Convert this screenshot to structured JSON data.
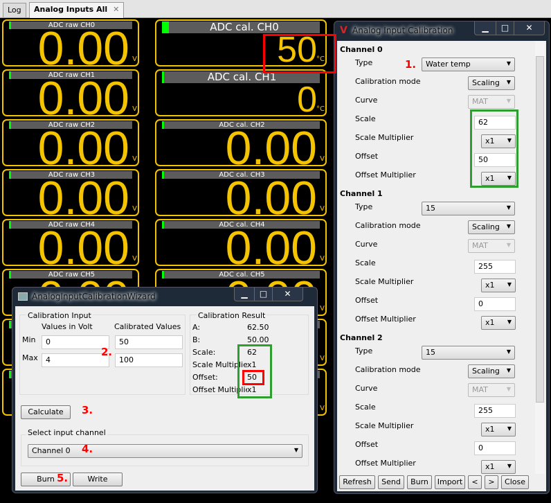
{
  "tabs": [
    {
      "label": "Log"
    },
    {
      "label": "Analog Inputs All",
      "close": "✕"
    }
  ],
  "gauges": {
    "raw": [
      {
        "title": "ADC raw CH0",
        "value": "0.00",
        "unit": "V"
      },
      {
        "title": "ADC raw CH1",
        "value": "0.00",
        "unit": "V"
      },
      {
        "title": "ADC raw CH2",
        "value": "0.00",
        "unit": "V"
      },
      {
        "title": "ADC raw CH3",
        "value": "0.00",
        "unit": "V"
      },
      {
        "title": "ADC raw CH4",
        "value": "0.00",
        "unit": "V"
      },
      {
        "title": "ADC raw CH5",
        "value": "0.00",
        "unit": "V"
      },
      {
        "title": "",
        "value": "",
        "unit": "V"
      },
      {
        "title": "",
        "value": "",
        "unit": "V"
      }
    ],
    "cal": [
      {
        "title": "ADC cal. CH0",
        "value": "50",
        "unit": "°C"
      },
      {
        "title": "ADC cal. CH1",
        "value": "0",
        "unit": "°C"
      },
      {
        "title": "ADC cal. CH2",
        "value": "0.00",
        "unit": "V"
      },
      {
        "title": "ADC cal. CH3",
        "value": "0.00",
        "unit": "V"
      },
      {
        "title": "ADC cal. CH4",
        "value": "0.00",
        "unit": "V"
      },
      {
        "title": "ADC cal. CH5",
        "value": "0.00",
        "unit": "V"
      },
      {
        "title": "",
        "value": "",
        "unit": "V"
      },
      {
        "title": "",
        "value": "",
        "unit": "V"
      }
    ]
  },
  "calib_window": {
    "title": "Analog Input Calibration",
    "controls": [
      "▁",
      "□",
      "✕"
    ],
    "field_labels": [
      "Type",
      "Calibration mode",
      "Curve",
      "Scale",
      "Scale Multiplier",
      "Offset",
      "Offset Multiplier"
    ],
    "channels": [
      {
        "name": "Channel 0",
        "type": "Water temp",
        "mode": "Scaling",
        "curve": "MAT",
        "scale": "62",
        "scale_mult": "x1",
        "offset": "50",
        "offset_mult": "x1"
      },
      {
        "name": "Channel 1",
        "type": "15",
        "mode": "Scaling",
        "curve": "MAT",
        "scale": "255",
        "scale_mult": "x1",
        "offset": "0",
        "offset_mult": "x1"
      },
      {
        "name": "Channel 2",
        "type": "15",
        "mode": "Scaling",
        "curve": "MAT",
        "scale": "255",
        "scale_mult": "x1",
        "offset": "0",
        "offset_mult": "x1"
      }
    ],
    "buttons": [
      "Refresh",
      "Send",
      "Burn",
      "Import",
      "<",
      ">",
      "Close"
    ]
  },
  "wizard": {
    "title": "AnalogInputCalibrationWizard",
    "controls": [
      "▁",
      "□",
      "✕"
    ],
    "input": {
      "group": "Calibration Input",
      "col_volt": "Values in Volt",
      "col_cal": "Calibrated Values",
      "min_label": "Min",
      "max_label": "Max",
      "min_volt": "0",
      "max_volt": "4",
      "min_cal": "50",
      "max_cal": "100"
    },
    "result": {
      "group": "Calibration Result",
      "rows": [
        {
          "label": "A:",
          "value": "62.50"
        },
        {
          "label": "B:",
          "value": "50.00"
        },
        {
          "label": "Scale:",
          "value": "62"
        },
        {
          "label": "Scale Multiplier",
          "value": "x1"
        },
        {
          "label": "Offset:",
          "value": "50"
        },
        {
          "label": "Offset Multiplier",
          "value": "x1"
        }
      ]
    },
    "calculate": "Calculate",
    "channel_group": "Select input channel",
    "channel": "Channel 0",
    "burn": "Burn",
    "write": "Write"
  },
  "annotations": [
    "1.",
    "2.",
    "3.",
    "4.",
    "5."
  ],
  "colors": {
    "gauge": "#f5c400",
    "highlight_red": "#ff0000",
    "highlight_green": "#2e9e2e"
  }
}
